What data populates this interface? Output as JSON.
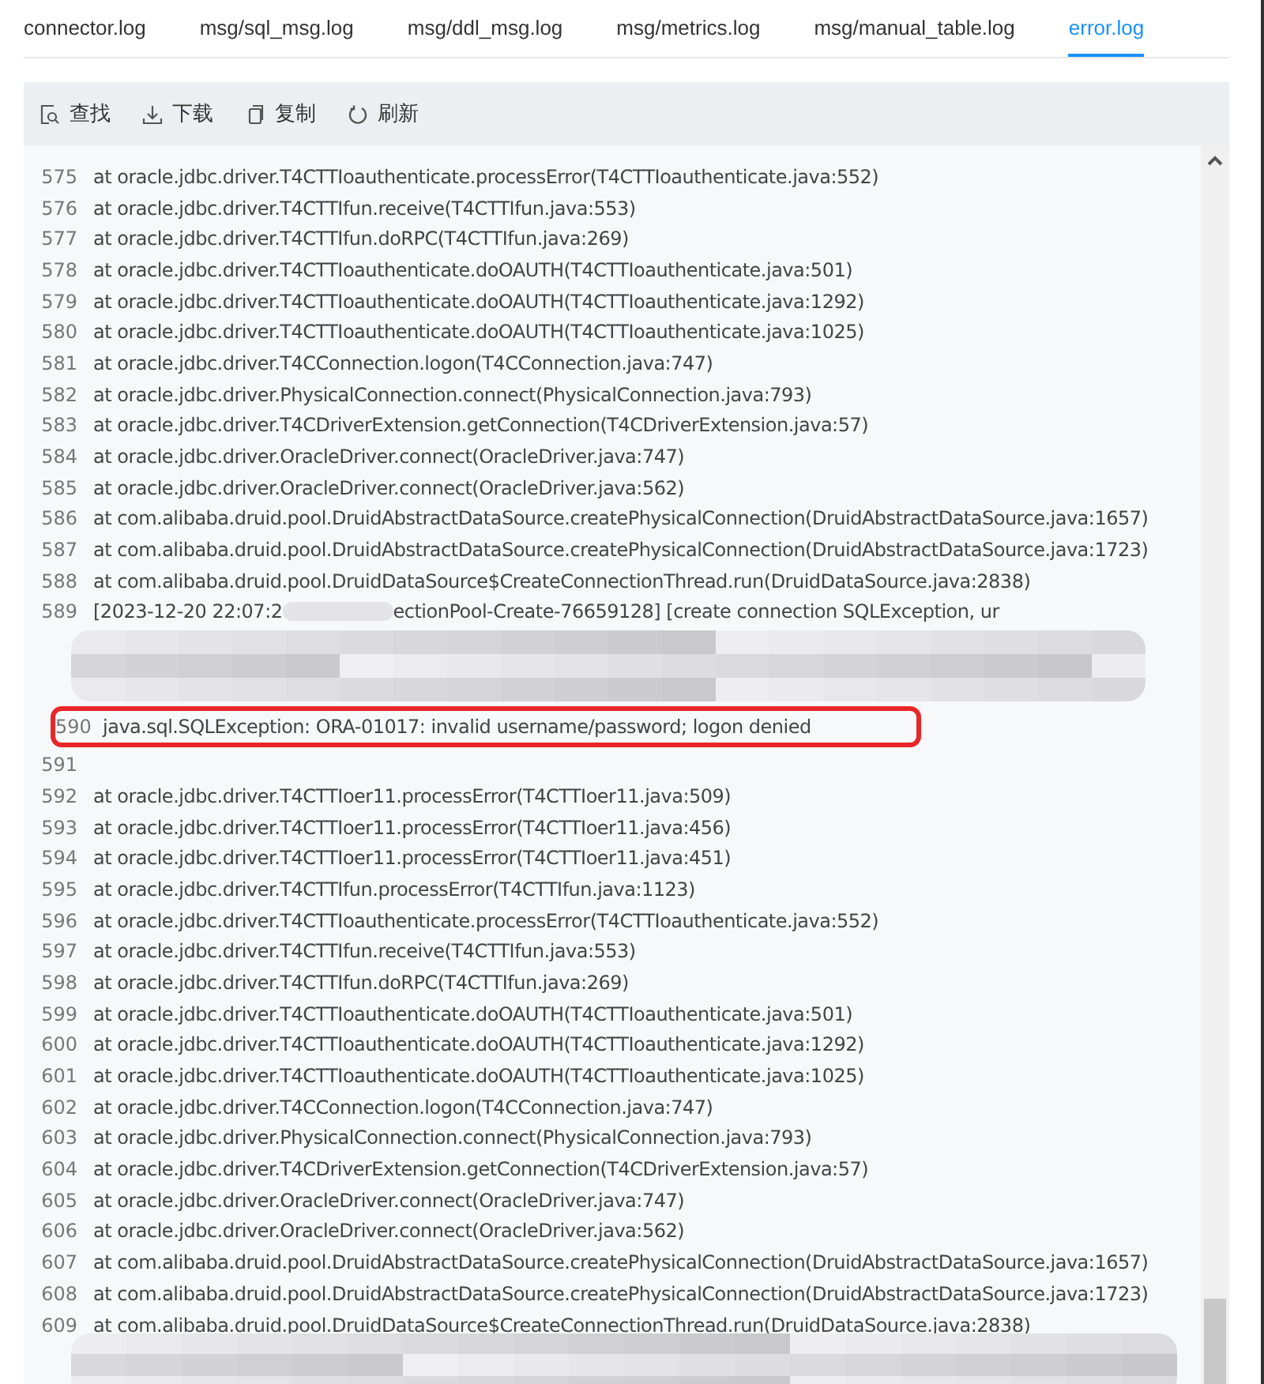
{
  "tabs": [
    {
      "label": "connector.log",
      "selected": false
    },
    {
      "label": "msg/sql_msg.log",
      "selected": false
    },
    {
      "label": "msg/ddl_msg.log",
      "selected": false
    },
    {
      "label": "msg/metrics.log",
      "selected": false
    },
    {
      "label": "msg/manual_table.log",
      "selected": false
    },
    {
      "label": "error.log",
      "selected": true
    }
  ],
  "toolbar": [
    {
      "kind": "find",
      "label": "查找"
    },
    {
      "kind": "download",
      "label": "下载"
    },
    {
      "kind": "copy",
      "label": "复制"
    },
    {
      "kind": "refresh",
      "label": "刷新"
    }
  ],
  "log_lines": [
    {
      "number": "575",
      "text": "at oracle.jdbc.driver.T4CTTIoauthenticate.processError(T4CTTIoauthenticate.java:552)",
      "highlighted": false
    },
    {
      "number": "576",
      "text": "at oracle.jdbc.driver.T4CTTIfun.receive(T4CTTIfun.java:553)",
      "highlighted": false
    },
    {
      "number": "577",
      "text": "at oracle.jdbc.driver.T4CTTIfun.doRPC(T4CTTIfun.java:269)",
      "highlighted": false
    },
    {
      "number": "578",
      "text": "at oracle.jdbc.driver.T4CTTIoauthenticate.doOAUTH(T4CTTIoauthenticate.java:501)",
      "highlighted": false
    },
    {
      "number": "579",
      "text": "at oracle.jdbc.driver.T4CTTIoauthenticate.doOAUTH(T4CTTIoauthenticate.java:1292)",
      "highlighted": false
    },
    {
      "number": "580",
      "text": "at oracle.jdbc.driver.T4CTTIoauthenticate.doOAUTH(T4CTTIoauthenticate.java:1025)",
      "highlighted": false
    },
    {
      "number": "581",
      "text": "at oracle.jdbc.driver.T4CConnection.logon(T4CConnection.java:747)",
      "highlighted": false
    },
    {
      "number": "582",
      "text": "at oracle.jdbc.driver.PhysicalConnection.connect(PhysicalConnection.java:793)",
      "highlighted": false
    },
    {
      "number": "583",
      "text": "at oracle.jdbc.driver.T4CDriverExtension.getConnection(T4CDriverExtension.java:57)",
      "highlighted": false
    },
    {
      "number": "584",
      "text": "at oracle.jdbc.driver.OracleDriver.connect(OracleDriver.java:747)",
      "highlighted": false
    },
    {
      "number": "585",
      "text": "at oracle.jdbc.driver.OracleDriver.connect(OracleDriver.java:562)",
      "highlighted": false
    },
    {
      "number": "586",
      "text": "at com.alibaba.druid.pool.DruidAbstractDataSource.createPhysicalConnection(DruidAbstractDataSource.java:1657)",
      "highlighted": false
    },
    {
      "number": "587",
      "text": "at com.alibaba.druid.pool.DruidAbstractDataSource.createPhysicalConnection(DruidAbstractDataSource.java:1723)",
      "highlighted": false
    },
    {
      "number": "588",
      "text": "at com.alibaba.druid.pool.DruidDataSource$CreateConnectionThread.run(DruidDataSource.java:2838)",
      "highlighted": false
    },
    {
      "number": "589",
      "kind": "redacted",
      "text": "[2023-12-20 22:07:2",
      "text_after": "ectionPool-Create-76659128] [create connection SQLException, ur",
      "highlighted": false
    },
    {
      "number": "590",
      "text": "java.sql.SQLException: ORA-01017: invalid username/password; logon denied",
      "highlighted": true
    },
    {
      "number": "591",
      "highlighted": false
    },
    {
      "number": "592",
      "text": "at oracle.jdbc.driver.T4CTTIoer11.processError(T4CTTIoer11.java:509)",
      "highlighted": false
    },
    {
      "number": "593",
      "text": "at oracle.jdbc.driver.T4CTTIoer11.processError(T4CTTIoer11.java:456)",
      "highlighted": false
    },
    {
      "number": "594",
      "text": "at oracle.jdbc.driver.T4CTTIoer11.processError(T4CTTIoer11.java:451)",
      "highlighted": false
    },
    {
      "number": "595",
      "text": "at oracle.jdbc.driver.T4CTTIfun.processError(T4CTTIfun.java:1123)",
      "highlighted": false
    },
    {
      "number": "596",
      "text": "at oracle.jdbc.driver.T4CTTIoauthenticate.processError(T4CTTIoauthenticate.java:552)",
      "highlighted": false
    },
    {
      "number": "597",
      "text": "at oracle.jdbc.driver.T4CTTIfun.receive(T4CTTIfun.java:553)",
      "highlighted": false
    },
    {
      "number": "598",
      "text": "at oracle.jdbc.driver.T4CTTIfun.doRPC(T4CTTIfun.java:269)",
      "highlighted": false
    },
    {
      "number": "599",
      "text": "at oracle.jdbc.driver.T4CTTIoauthenticate.doOAUTH(T4CTTIoauthenticate.java:501)",
      "highlighted": false
    },
    {
      "number": "600",
      "text": "at oracle.jdbc.driver.T4CTTIoauthenticate.doOAUTH(T4CTTIoauthenticate.java:1292)",
      "highlighted": false
    },
    {
      "number": "601",
      "text": "at oracle.jdbc.driver.T4CTTIoauthenticate.doOAUTH(T4CTTIoauthenticate.java:1025)",
      "highlighted": false
    },
    {
      "number": "602",
      "text": "at oracle.jdbc.driver.T4CConnection.logon(T4CConnection.java:747)",
      "highlighted": false
    },
    {
      "number": "603",
      "text": "at oracle.jdbc.driver.PhysicalConnection.connect(PhysicalConnection.java:793)",
      "highlighted": false
    },
    {
      "number": "604",
      "text": "at oracle.jdbc.driver.T4CDriverExtension.getConnection(T4CDriverExtension.java:57)",
      "highlighted": false
    },
    {
      "number": "605",
      "text": "at oracle.jdbc.driver.OracleDriver.connect(OracleDriver.java:747)",
      "highlighted": false
    },
    {
      "number": "606",
      "text": "at oracle.jdbc.driver.OracleDriver.connect(OracleDriver.java:562)",
      "highlighted": false
    },
    {
      "number": "607",
      "text": "at com.alibaba.druid.pool.DruidAbstractDataSource.createPhysicalConnection(DruidAbstractDataSource.java:1657)",
      "highlighted": false
    },
    {
      "number": "608",
      "text": "at com.alibaba.druid.pool.DruidAbstractDataSource.createPhysicalConnection(DruidAbstractDataSource.java:1723)",
      "highlighted": false
    },
    {
      "number": "609",
      "text": "at com.alibaba.druid.pool.DruidDataSource$CreateConnectionThread.run(DruidDataSource.java:2838)",
      "highlighted": false
    }
  ]
}
